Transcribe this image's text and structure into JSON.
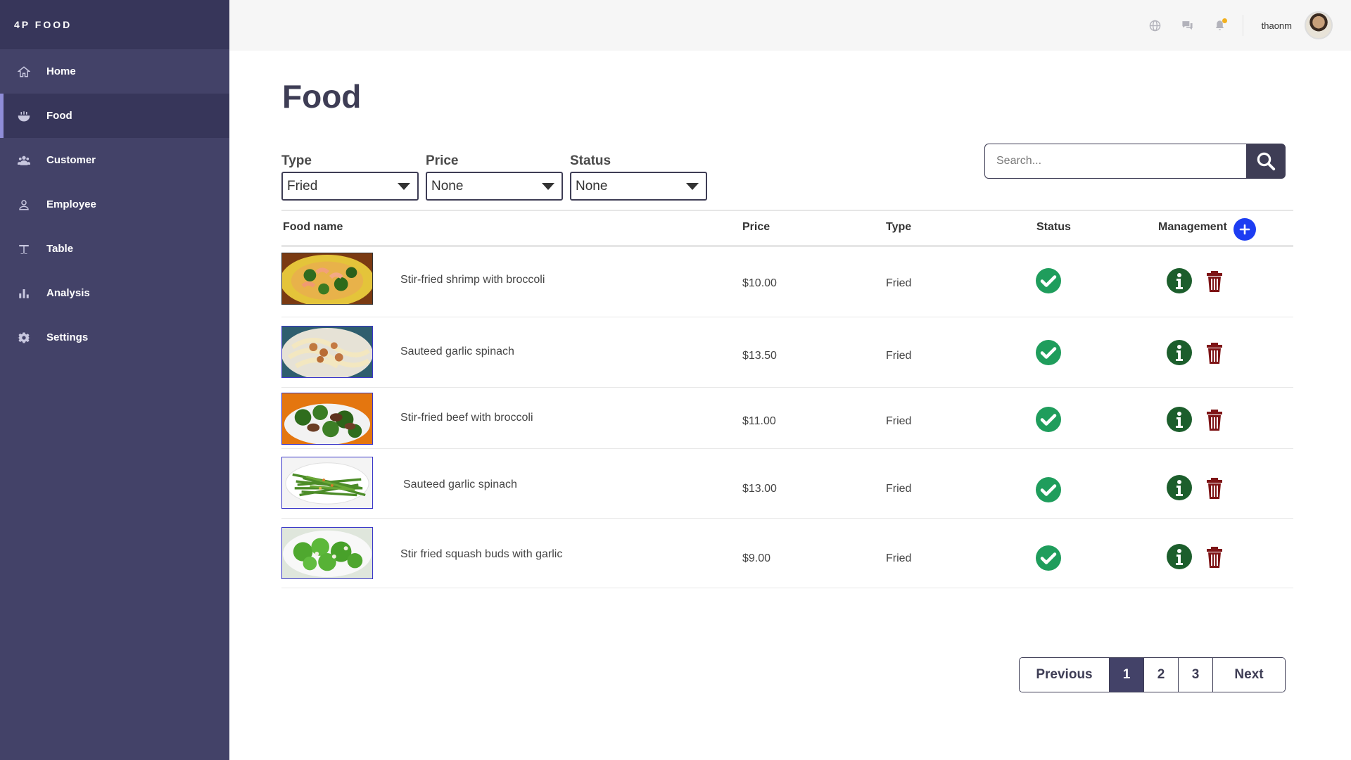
{
  "brand": "4P FOOD",
  "sidebar": {
    "items": [
      {
        "label": "Home",
        "icon": "home-icon"
      },
      {
        "label": "Food",
        "icon": "food-bowl-icon",
        "active": true
      },
      {
        "label": "Customer",
        "icon": "users-icon"
      },
      {
        "label": "Employee",
        "icon": "user-icon"
      },
      {
        "label": "Table",
        "icon": "table-icon"
      },
      {
        "label": "Analysis",
        "icon": "bar-chart-icon"
      },
      {
        "label": "Settings",
        "icon": "gear-icon"
      }
    ]
  },
  "topbar": {
    "icons": [
      "globe-icon",
      "chat-icon",
      "bell-icon"
    ],
    "username": "thaonm"
  },
  "page": {
    "title": "Food"
  },
  "filters": {
    "type": {
      "label": "Type",
      "value": "Fried"
    },
    "price": {
      "label": "Price",
      "value": "None"
    },
    "status": {
      "label": "Status",
      "value": "None"
    }
  },
  "search": {
    "placeholder": "Search..."
  },
  "table": {
    "headers": {
      "name": "Food name",
      "price": "Price",
      "type": "Type",
      "status": "Status",
      "management": "Management"
    },
    "rows": [
      {
        "name": "Stir-fried shrimp with broccoli",
        "price": "$10.00",
        "type": "Fried",
        "status": "available"
      },
      {
        "name": "Sauteed garlic spinach",
        "price": "$13.50",
        "type": "Fried",
        "status": "available"
      },
      {
        "name": "Stir-fried beef with broccoli",
        "price": "$11.00",
        "type": "Fried",
        "status": "available"
      },
      {
        "name": "Sauteed garlic spinach",
        "price": "$13.00",
        "type": "Fried",
        "status": "available"
      },
      {
        "name": "Stir fried squash buds with garlic",
        "price": "$9.00",
        "type": "Fried",
        "status": "available"
      }
    ]
  },
  "pagination": {
    "previous": "Previous",
    "pages": [
      "1",
      "2",
      "3"
    ],
    "current": "1",
    "next": "Next"
  },
  "colors": {
    "sidebar": "#434268",
    "accent": "#3e3d55",
    "status_ok": "#1f9d5c",
    "info": "#1c5e2c",
    "delete": "#7e1416",
    "add": "#1d3df2"
  }
}
